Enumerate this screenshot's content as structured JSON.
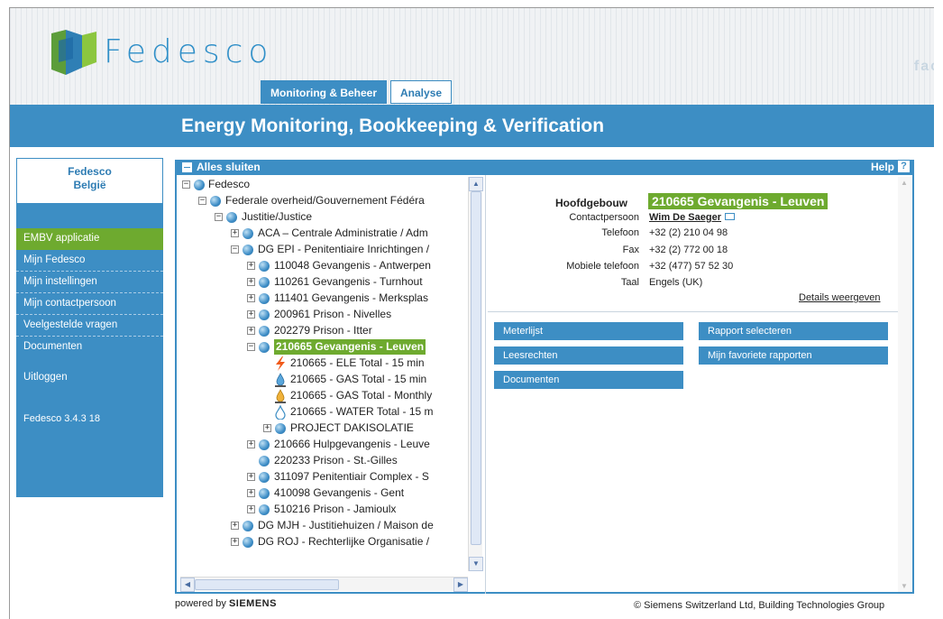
{
  "header": {
    "brand": "Fedesco",
    "right_text": "fac",
    "tabs": [
      {
        "label": "Monitoring & Beheer",
        "active": true
      },
      {
        "label": "Analyse",
        "active": false
      }
    ],
    "title": "Energy Monitoring, Bookkeeping & Verification"
  },
  "sidebar": {
    "org_name": "Fedesco",
    "org_country": "België",
    "menu": [
      {
        "label": "EMBV applicatie"
      },
      {
        "label": "Mijn Fedesco"
      },
      {
        "label": "Mijn instellingen"
      },
      {
        "label": "Mijn contactpersoon"
      },
      {
        "label": "Veelgestelde vragen"
      },
      {
        "label": "Documenten"
      }
    ],
    "logout": "Uitloggen",
    "version": "Fedesco 3.4.3 18"
  },
  "panel": {
    "collapse_label": "Alles sluiten",
    "help_label": "Help",
    "help_icon_glyph": "?"
  },
  "tree": [
    {
      "label": "Fedesco"
    },
    {
      "label": "Federale overheid/Gouvernement Fédéra"
    },
    {
      "label": "Justitie/Justice"
    },
    {
      "label": "ACA – Centrale Administratie / Adm"
    },
    {
      "label": "DG EPI - Penitentiaire Inrichtingen /"
    },
    {
      "label": "110048 Gevangenis - Antwerpen"
    },
    {
      "label": "110261 Gevangenis - Turnhout"
    },
    {
      "label": "111401 Gevangenis - Merksplas"
    },
    {
      "label": "200961 Prison - Nivelles"
    },
    {
      "label": "202279 Prison - Itter"
    },
    {
      "label": "210665 Gevangenis - Leuven"
    },
    {
      "label": "210665 - ELE Total - 15 min"
    },
    {
      "label": "210665 - GAS Total - 15 min"
    },
    {
      "label": "210665 - GAS Total - Monthly"
    },
    {
      "label": "210665 - WATER Total - 15 m"
    },
    {
      "label": "PROJECT DAKISOLATIE"
    },
    {
      "label": "210666 Hulpgevangenis - Leuve"
    },
    {
      "label": "220233 Prison - St.-Gilles"
    },
    {
      "label": "311097 Penitentiair Complex - S"
    },
    {
      "label": "410098 Gevangenis - Gent"
    },
    {
      "label": "510216 Prison - Jamioulx"
    },
    {
      "label": "DG MJH - Justitiehuizen / Maison de"
    },
    {
      "label": "DG ROJ - Rechterlijke Organisatie /"
    }
  ],
  "detail": {
    "building_label": "Hoofdgebouw",
    "building_name": "210665 Gevangenis - Leuven",
    "contact_label": "Contactpersoon",
    "contact_value": "Wim De Saeger",
    "phone_label": "Telefoon",
    "phone_value": "+32 (2) 210 04 98",
    "fax_label": "Fax",
    "fax_value": "+32 (2) 772 00 18",
    "mobile_label": "Mobiele telefoon",
    "mobile_value": "+32 (477) 57 52 30",
    "lang_label": "Taal",
    "lang_value": "Engels (UK)",
    "details_link": "Details weergeven",
    "buttons_left": [
      "Meterlijst",
      "Leesrechten",
      "Documenten"
    ],
    "buttons_right": [
      "Rapport selecteren",
      "Mijn favoriete rapporten"
    ]
  },
  "footer": {
    "powered_by": "powered by",
    "powered_brand": "SIEMENS",
    "copyright": "© Siemens Switzerland Ltd, Building Technologies Group"
  },
  "colors": {
    "accent": "#3d8ec4",
    "highlight": "#6eaa2f"
  }
}
